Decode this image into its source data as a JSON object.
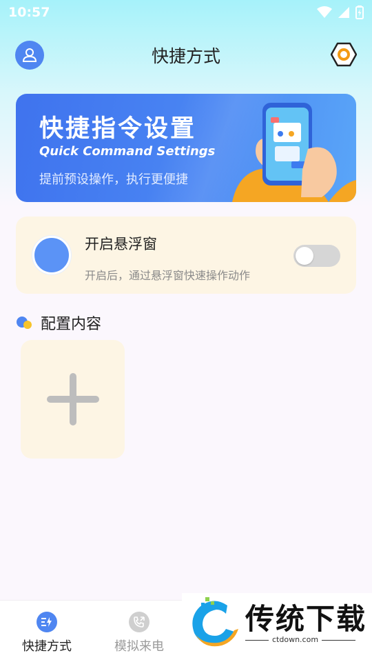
{
  "status_bar": {
    "time": "10:57"
  },
  "header": {
    "title": "快捷方式"
  },
  "banner": {
    "title": "快捷指令设置",
    "subtitle": "Quick Command Settings",
    "description": "提前预设操作，执行更便捷"
  },
  "float_window": {
    "title": "开启悬浮窗",
    "description": "开启后，通过悬浮窗快速操作动作",
    "enabled": false
  },
  "config": {
    "title": "配置内容"
  },
  "bottom_nav": {
    "items": [
      {
        "label": "快捷方式",
        "icon": "lightning-menu-icon",
        "active": true
      },
      {
        "label": "模拟来电",
        "icon": "phone-call-icon",
        "active": false
      }
    ]
  },
  "watermark": {
    "text": "传统下载",
    "url": "ctdown.com"
  },
  "colors": {
    "accent": "#4f86f1",
    "card_bg": "#fdf5e4",
    "header_gradient_top": "#a6f2fa",
    "settings_orange": "#f39a13"
  }
}
